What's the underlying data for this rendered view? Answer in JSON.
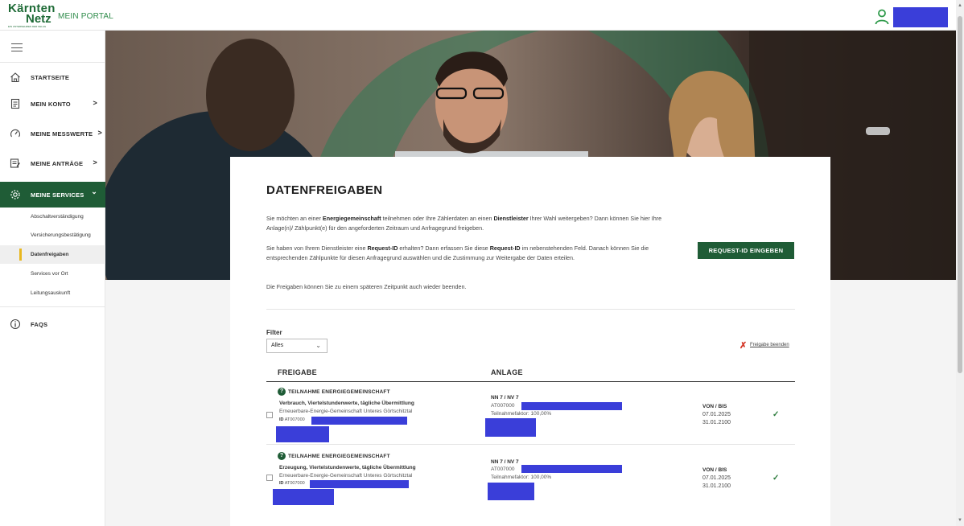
{
  "header": {
    "logo_line1": "Kärnten",
    "logo_line2": "Netz",
    "logo_tagline": "EIN UNTERNEHMEN DER KELAG",
    "portal_title": "MEIN PORTAL",
    "user_icon": "user-icon"
  },
  "sidebar": {
    "menu_icon": "hamburger-icon",
    "items": [
      {
        "label": "STARTSEITE",
        "icon": "home-icon"
      },
      {
        "label": "MEIN KONTO",
        "icon": "document-icon"
      },
      {
        "label": "MEINE MESSWERTE",
        "icon": "gauge-icon"
      },
      {
        "label": "MEINE ANTRÄGE",
        "icon": "form-icon"
      },
      {
        "label": "MEINE SERVICES",
        "icon": "gear-icon"
      },
      {
        "label": "FAQS",
        "icon": "info-icon"
      }
    ],
    "chevron": ">",
    "chevron_open": "⌄",
    "subitems": [
      {
        "label": "Abschaltverständigung"
      },
      {
        "label": "Versicherungsbestätigung"
      },
      {
        "label": "Datenfreigaben"
      },
      {
        "label": "Services vor Ort"
      },
      {
        "label": "Leitungsauskunft"
      }
    ]
  },
  "main": {
    "title": "DATENFREIGABEN",
    "para1": {
      "t1": "Sie möchten an einer ",
      "b1": "Energiegemeinschaft",
      "t2": " teilnehmen oder Ihre Zählerdaten an einen ",
      "b2": "Dienstleister",
      "t3": " Ihrer Wahl weitergeben? Dann können Sie hier Ihre Anlage(n)/ Zählpunkt(e) für den angeforderten Zeitraum und Anfragegrund freigeben."
    },
    "para2": {
      "t1": "Sie haben von Ihrem Dienstleister eine ",
      "b1": "Request-ID",
      "t2": " erhalten? Dann erfassen Sie diese ",
      "b2": "Request-ID",
      "t3": " im nebenstehenden Feld. Danach können Sie die entsprechenden Zählpunkte für diesen Anfragegrund auswählen und die Zustimmung zur Weitergabe der Daten erteilen."
    },
    "para3": "Die Freigaben können Sie zu einem späteren Zeitpunkt auch wieder beenden.",
    "request_button": "REQUEST-ID EINGEBEN",
    "filter_label": "Filter",
    "filter_value": "Alles",
    "filter_arrow": "⌄",
    "end_icon": "✗",
    "end_label": "Freigabe beenden",
    "col_freigabe": "FREIGABE",
    "col_anlage": "ANLAGE",
    "rows": [
      {
        "title": "TEILNAHME ENERGIEGEMEINSCHAFT",
        "subtitle": "Verbrauch, Viertelstundenwerte, tägliche Übermittlung",
        "name": "Erneuerbare-Energie-Gemeinschaft Unteres Görtschitztal",
        "id_label": "ID",
        "id_prefix": "AT007000",
        "anlage_title": "NN 7 / NV 7",
        "anlage_prefix": "AT007000",
        "factor_label": "Teilnahmefaktor:",
        "factor_value": "100,00%",
        "period_label": "VON / BIS",
        "from": "07.01.2025",
        "to": "31.01.2100",
        "status_icon": "✓"
      },
      {
        "title": "TEILNAHME ENERGIEGEMEINSCHAFT",
        "subtitle": "Erzeugung, Viertelstundenwerte, tägliche Übermittlung",
        "name": "Erneuerbare-Energie-Gemeinschaft Unteres Görtschitztal",
        "id_label": "ID",
        "id_prefix": "AT007000",
        "anlage_title": "NN 7 / NV 7",
        "anlage_prefix": "AT007000",
        "factor_label": "Teilnahmefaktor:",
        "factor_value": "100,00%",
        "period_label": "VON / BIS",
        "from": "07.01.2025",
        "to": "31.01.2100",
        "status_icon": "✓"
      }
    ]
  },
  "colors": {
    "brand_green": "#1f5c36",
    "accent_yellow": "#e8b71e",
    "redaction_blue": "#3a3ed9",
    "end_red": "#d53a2a"
  }
}
